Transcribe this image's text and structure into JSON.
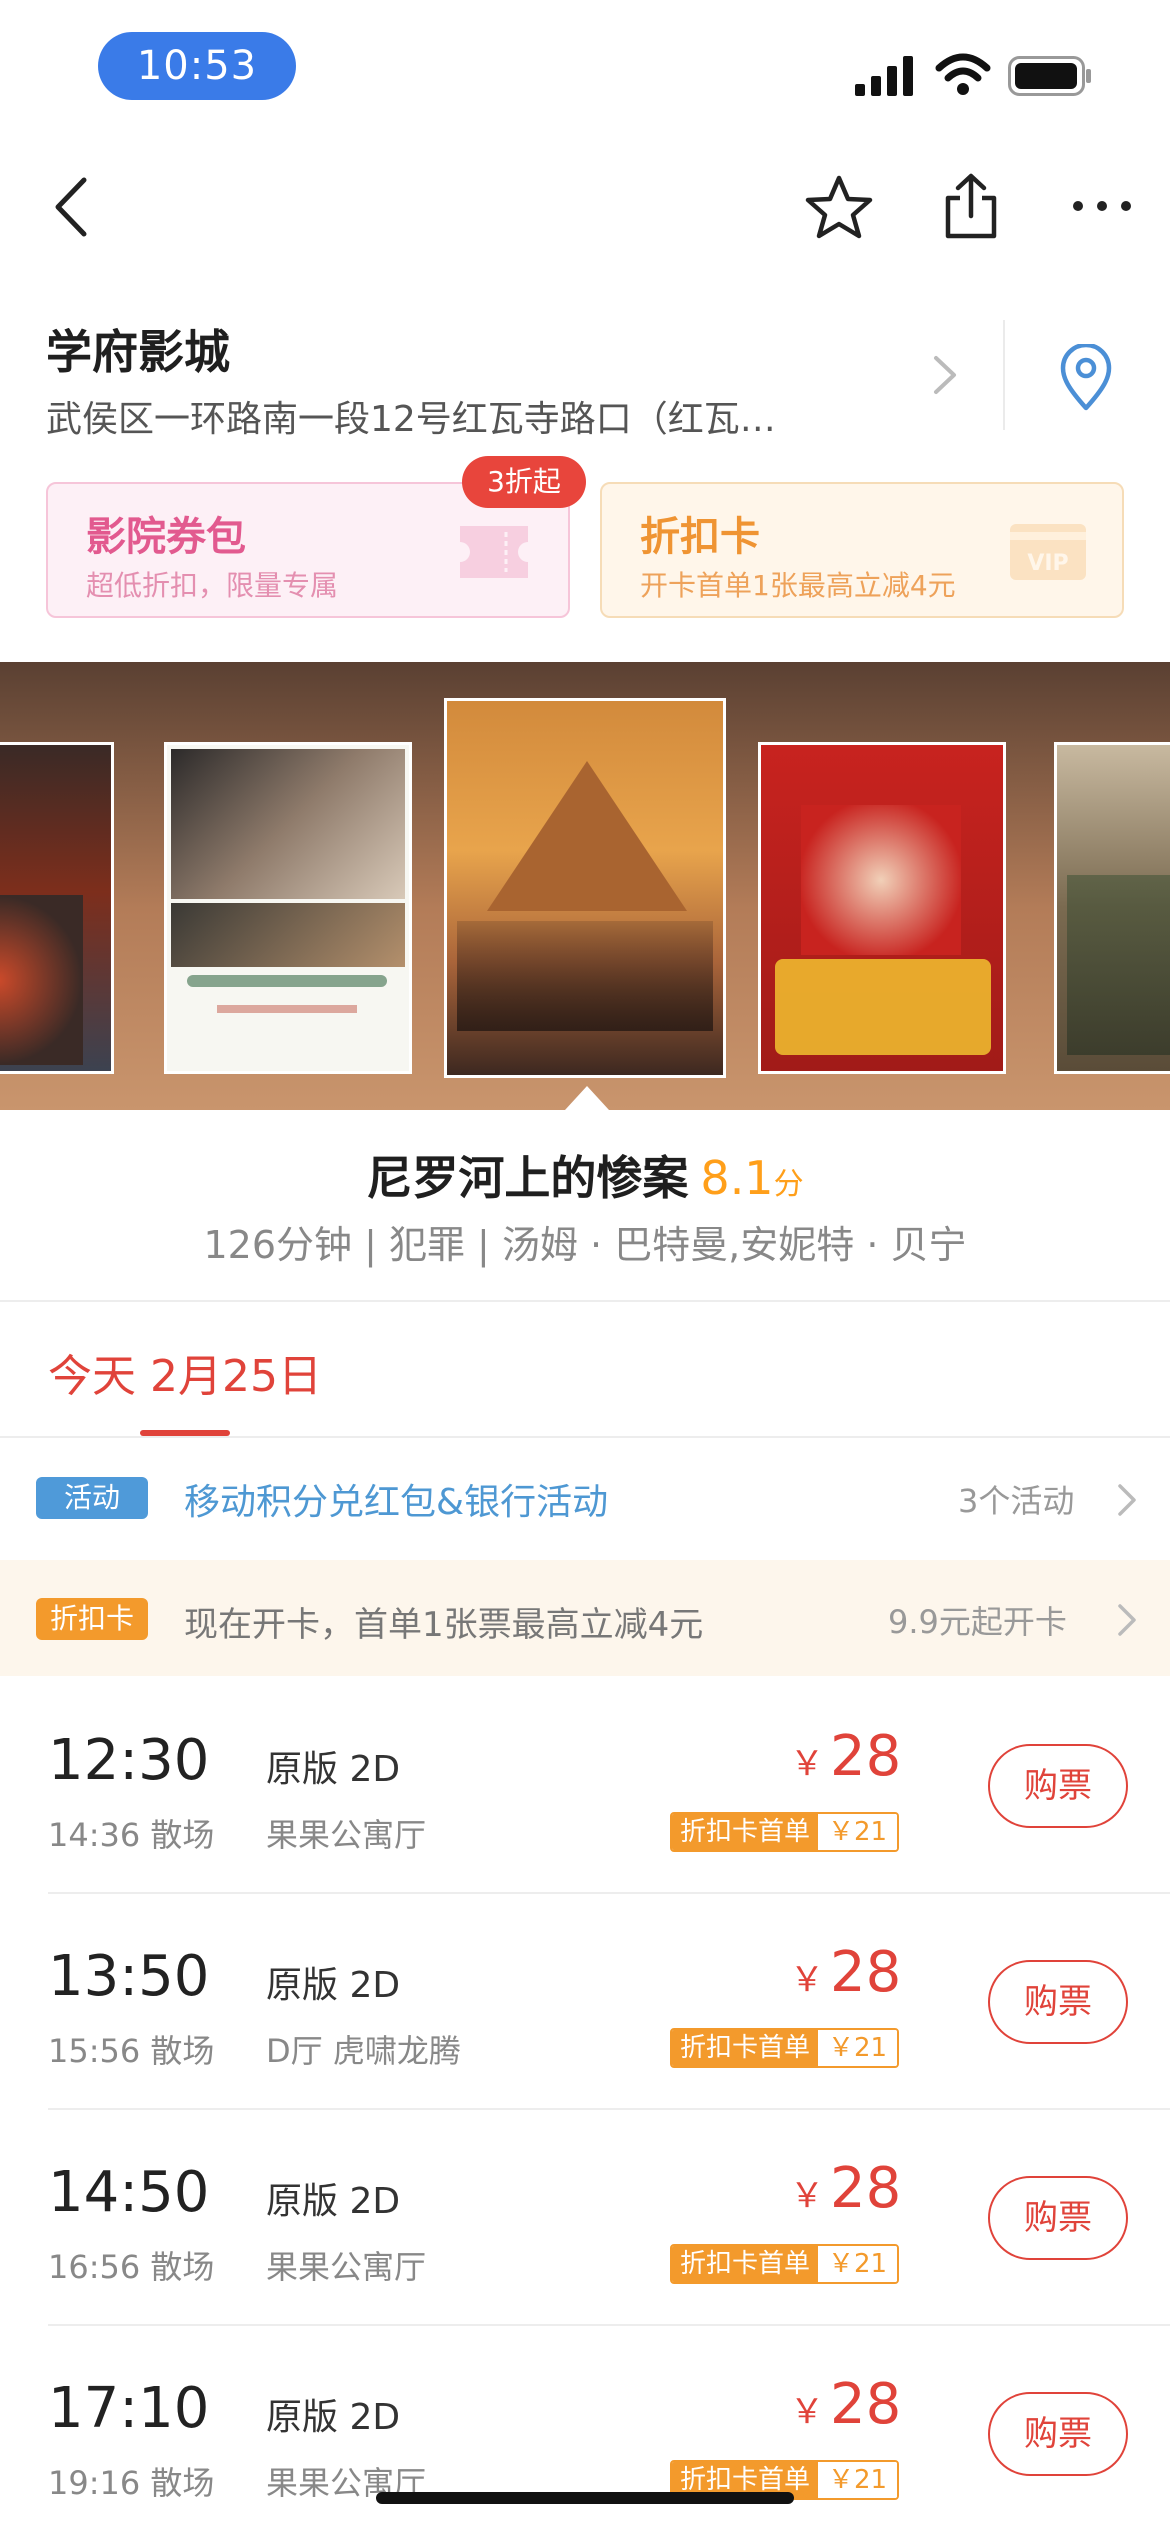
{
  "status_bar": {
    "time": "10:53"
  },
  "cinema": {
    "name": "学府影城",
    "address": "武侯区一环路南一段12号红瓦寺路口（红瓦…"
  },
  "coupons": {
    "coupon_pack": {
      "title": "影院券包",
      "subtitle": "超低折扣，限量专属",
      "badge": "3折起"
    },
    "discount_card": {
      "title": "折扣卡",
      "subtitle": "开卡首单1张最高立减4元"
    }
  },
  "movie": {
    "title": "尼罗河上的惨案",
    "score": "8.1",
    "score_unit": "分",
    "meta": "126分钟 | 犯罪 | 汤姆 · 巴特曼,安妮特 · 贝宁"
  },
  "date_tab": {
    "label": "今天 2月25日"
  },
  "activity": {
    "tag": "活动",
    "text": "移动积分兑红包&银行活动",
    "count": "3个活动"
  },
  "discount_promo": {
    "tag": "折扣卡",
    "text": "现在开卡，首单1张票最高立减4元",
    "price": "9.9元起开卡"
  },
  "showtimes": [
    {
      "time": "12:30",
      "end": "14:36 散场",
      "version": "原版 2D",
      "hall": "果果公寓厅",
      "price": "28",
      "card_label": "折扣卡首单",
      "card_price": "￥21",
      "buy": "购票"
    },
    {
      "time": "13:50",
      "end": "15:56 散场",
      "version": "原版 2D",
      "hall": "D厅 虎啸龙腾",
      "price": "28",
      "card_label": "折扣卡首单",
      "card_price": "￥21",
      "buy": "购票"
    },
    {
      "time": "14:50",
      "end": "16:56 散场",
      "version": "原版 2D",
      "hall": "果果公寓厅",
      "price": "28",
      "card_label": "折扣卡首单",
      "card_price": "￥21",
      "buy": "购票"
    },
    {
      "time": "17:10",
      "end": "19:16 散场",
      "version": "原版 2D",
      "hall": "果果公寓厅",
      "price": "28",
      "card_label": "折扣卡首单",
      "card_price": "￥21",
      "buy": "购票"
    }
  ],
  "currency_symbol": "￥",
  "colors": {
    "accent_red": "#e0433a",
    "accent_orange": "#f39a2c",
    "link_blue": "#4e98d3"
  }
}
